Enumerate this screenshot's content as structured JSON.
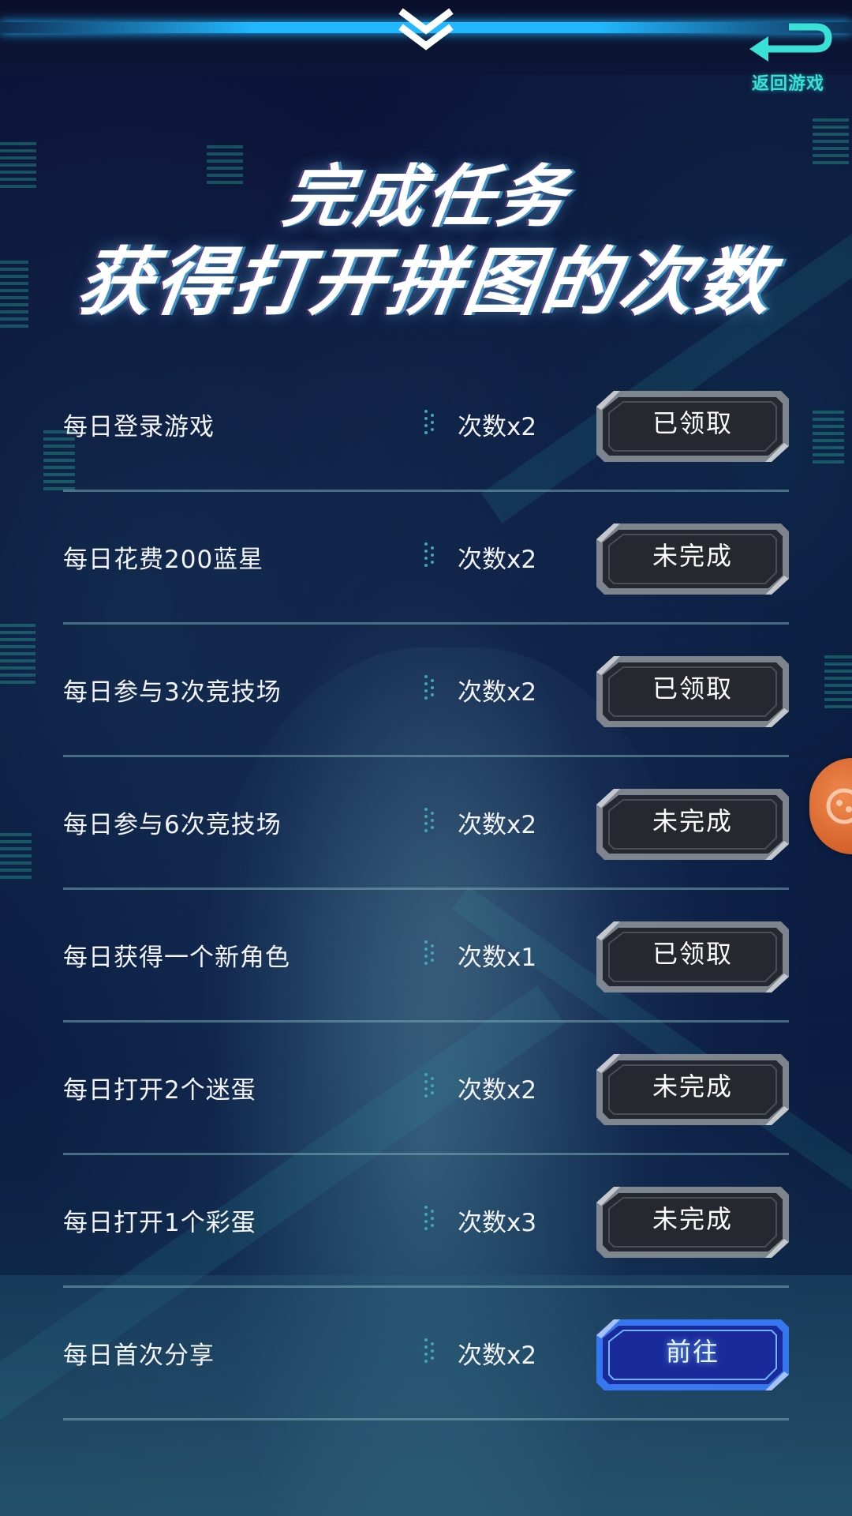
{
  "header": {
    "back_label": "返回游戏",
    "collapse_icon": "double-chevron-down-icon",
    "back_icon": "return-arrow-icon"
  },
  "heading": {
    "line1": "完成任务",
    "line2": "获得打开拼图的次数"
  },
  "tasks": [
    {
      "name": "每日登录游戏",
      "reward": "次数x2",
      "status": "已领取",
      "state": "claimed"
    },
    {
      "name": "每日花费200蓝星",
      "reward": "次数x2",
      "status": "未完成",
      "state": "incomplete"
    },
    {
      "name": "每日参与3次竞技场",
      "reward": "次数x2",
      "status": "已领取",
      "state": "claimed"
    },
    {
      "name": "每日参与6次竞技场",
      "reward": "次数x2",
      "status": "未完成",
      "state": "incomplete"
    },
    {
      "name": "每日获得一个新角色",
      "reward": "次数x1",
      "status": "已领取",
      "state": "claimed"
    },
    {
      "name": "每日打开2个迷蛋",
      "reward": "次数x2",
      "status": "未完成",
      "state": "incomplete"
    },
    {
      "name": "每日打开1个彩蛋",
      "reward": "次数x3",
      "status": "未完成",
      "state": "incomplete"
    },
    {
      "name": "每日首次分享",
      "reward": "次数x2",
      "status": "前往",
      "state": "go"
    }
  ],
  "colors": {
    "accent_cyan": "#22b8ff",
    "back_teal": "#38e0d6",
    "button_dark": "#2a2d33",
    "button_go": "#1a2a9a",
    "float_orange": "#d4622a"
  },
  "floating_button_icon": "game-controller-icon"
}
